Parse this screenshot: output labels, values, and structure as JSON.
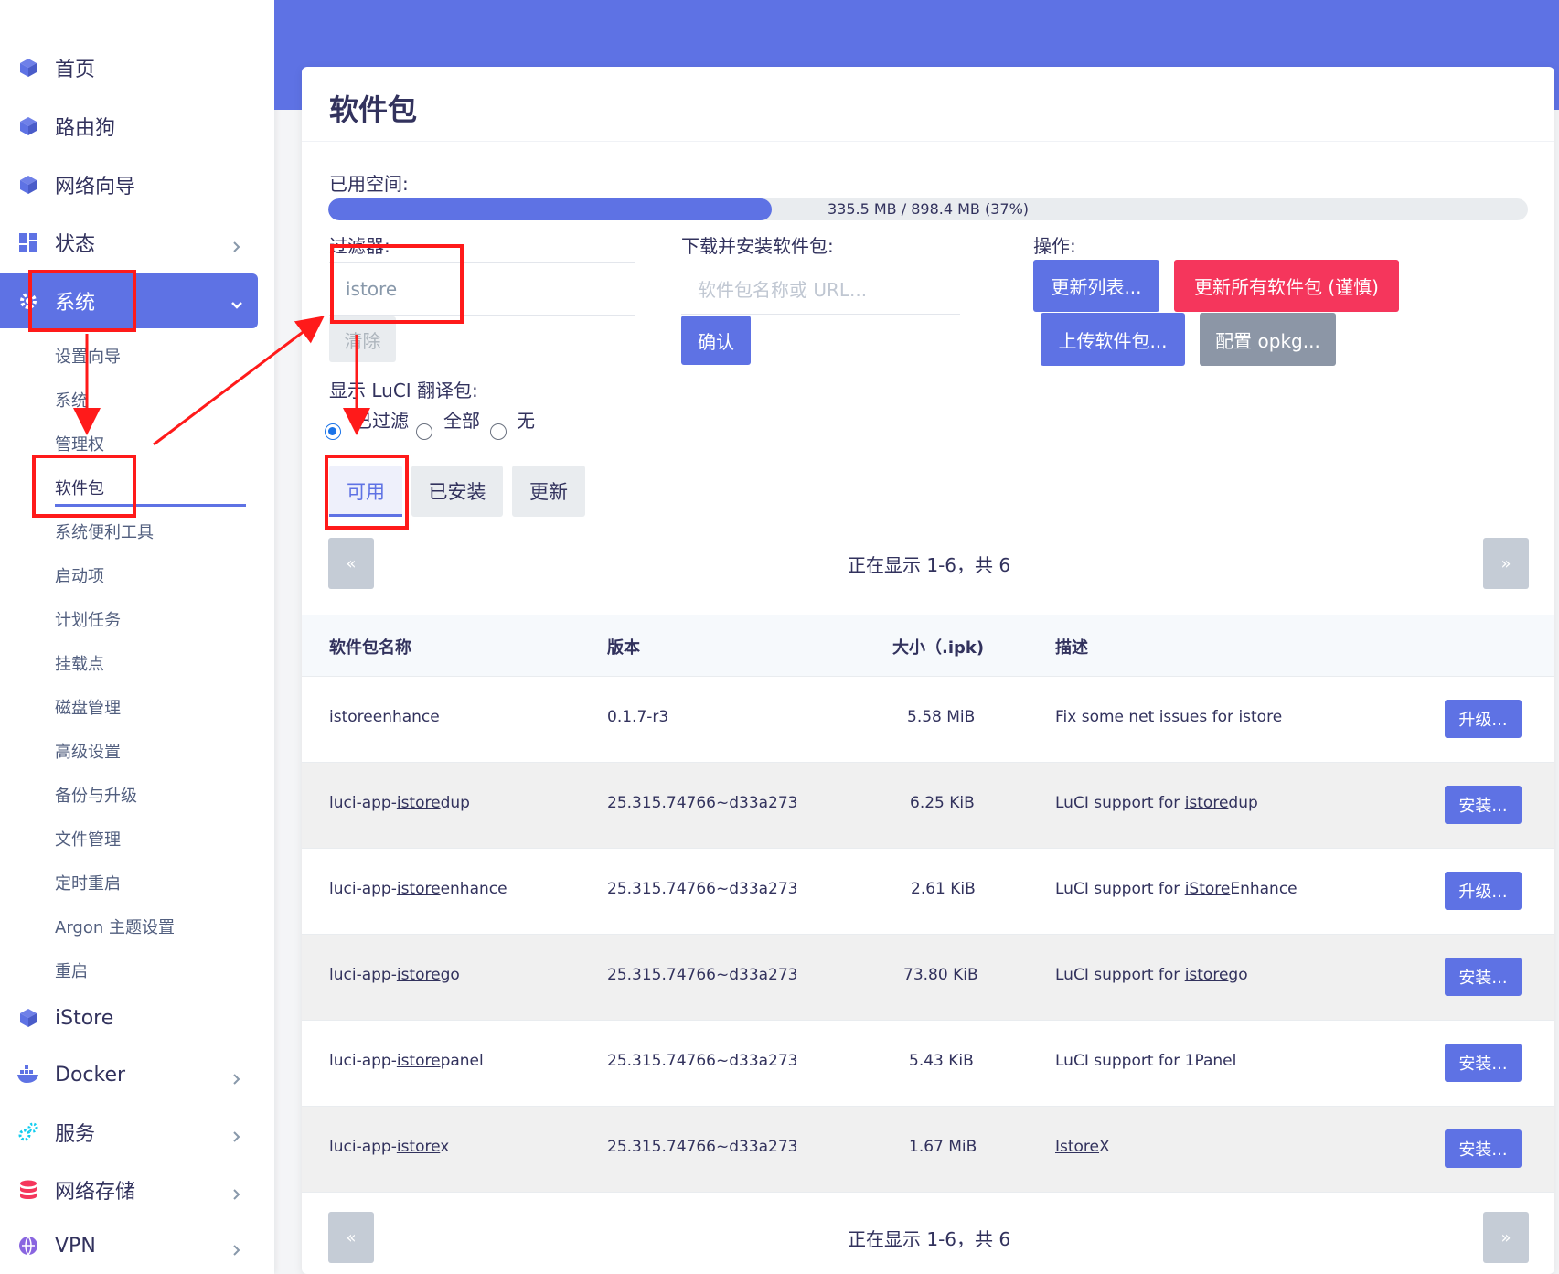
{
  "sidebar": {
    "items": [
      {
        "label": "首页",
        "icon": "cube-icon"
      },
      {
        "label": "路由狗",
        "icon": "cube-icon"
      },
      {
        "label": "网络向导",
        "icon": "cube-icon"
      },
      {
        "label": "状态",
        "icon": "grid-icon"
      },
      {
        "label": "系统",
        "icon": "gear-icon"
      },
      {
        "label": "iStore",
        "icon": "cube-icon"
      },
      {
        "label": "Docker",
        "icon": "docker-icon"
      },
      {
        "label": "服务",
        "icon": "services-icon"
      },
      {
        "label": "网络存储",
        "icon": "database-icon"
      },
      {
        "label": "VPN",
        "icon": "vpn-icon"
      }
    ],
    "system_sub": [
      "设置向导",
      "系统",
      "管理权",
      "软件包",
      "系统便利工具",
      "启动项",
      "计划任务",
      "挂载点",
      "磁盘管理",
      "高级设置",
      "备份与升级",
      "文件管理",
      "定时重启",
      "Argon 主题设置",
      "重启"
    ]
  },
  "page": {
    "title": "软件包",
    "used_space_label": "已用空间:",
    "progress_text": "335.5 MB / 898.4 MB (37%)",
    "progress_percent": 37,
    "filter_label": "过滤器:",
    "filter_value": "istore",
    "clear_label": "清除",
    "download_label": "下载并安装软件包:",
    "download_placeholder": "软件包名称或 URL...",
    "confirm_label": "确认",
    "actions_label": "操作:",
    "update_list": "更新列表...",
    "update_all": "更新所有软件包 (谨慎)",
    "upload": "上传软件包...",
    "config_opkg": "配置 opkg...",
    "luci_label": "显示 LuCI 翻译包:",
    "radio_filtered": "已过滤",
    "radio_all": "全部",
    "radio_none": "无",
    "tab_available": "可用",
    "tab_installed": "已安装",
    "tab_updates": "更新",
    "pager_prev": "«",
    "pager_next": "»",
    "pager_text": "正在显示 1-6，共 6"
  },
  "table": {
    "headers": [
      "软件包名称",
      "版本",
      "大小（.ipk)",
      "描述"
    ],
    "rows": [
      {
        "pre": "",
        "hl": "istore",
        "post": "enhance",
        "version": "0.1.7-r3",
        "size": "5.58 MiB",
        "d_pre": "Fix some net issues for ",
        "d_hl": "istore",
        "d_post": "",
        "action": "升级..."
      },
      {
        "pre": "luci-app-",
        "hl": "istore",
        "post": "dup",
        "version": "25.315.74766~d33a273",
        "size": "6.25 KiB",
        "d_pre": "LuCI support for ",
        "d_hl": "istore",
        "d_post": "dup",
        "action": "安装..."
      },
      {
        "pre": "luci-app-",
        "hl": "istore",
        "post": "enhance",
        "version": "25.315.74766~d33a273",
        "size": "2.61 KiB",
        "d_pre": "LuCI support for ",
        "d_hl": "iStore",
        "d_post": "Enhance",
        "action": "升级..."
      },
      {
        "pre": "luci-app-",
        "hl": "istore",
        "post": "go",
        "version": "25.315.74766~d33a273",
        "size": "73.80 KiB",
        "d_pre": "LuCI support for ",
        "d_hl": "istore",
        "d_post": "go",
        "action": "安装..."
      },
      {
        "pre": "luci-app-",
        "hl": "istore",
        "post": "panel",
        "version": "25.315.74766~d33a273",
        "size": "5.43 KiB",
        "d_pre": "LuCI support for 1Panel",
        "d_hl": "",
        "d_post": "",
        "action": "安装..."
      },
      {
        "pre": "luci-app-",
        "hl": "istore",
        "post": "x",
        "version": "25.315.74766~d33a273",
        "size": "1.67 MiB",
        "d_pre": "",
        "d_hl": "Istore",
        "d_post": "X",
        "action": "安装..."
      }
    ]
  },
  "colors": {
    "accent": "#5e72e4",
    "danger": "#f5365c",
    "annotation": "#ff1a1a"
  }
}
